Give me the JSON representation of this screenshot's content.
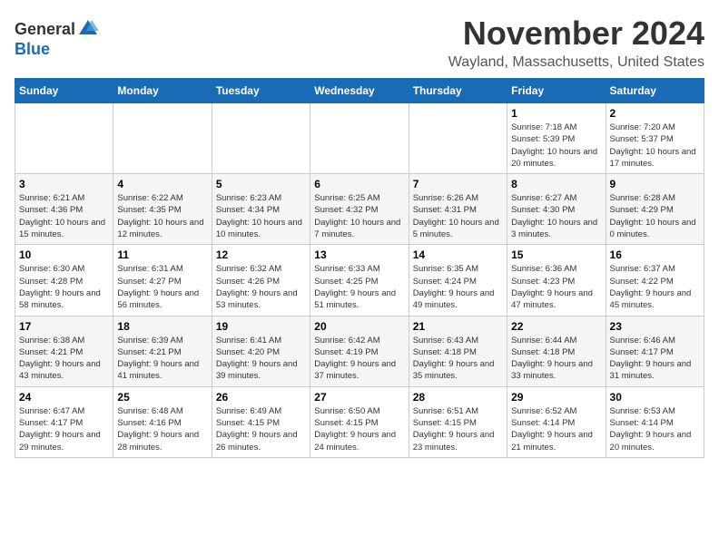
{
  "logo": {
    "general": "General",
    "blue": "Blue"
  },
  "header": {
    "month": "November 2024",
    "location": "Wayland, Massachusetts, United States"
  },
  "weekdays": [
    "Sunday",
    "Monday",
    "Tuesday",
    "Wednesday",
    "Thursday",
    "Friday",
    "Saturday"
  ],
  "weeks": [
    [
      {
        "day": "",
        "info": ""
      },
      {
        "day": "",
        "info": ""
      },
      {
        "day": "",
        "info": ""
      },
      {
        "day": "",
        "info": ""
      },
      {
        "day": "",
        "info": ""
      },
      {
        "day": "1",
        "info": "Sunrise: 7:18 AM\nSunset: 5:39 PM\nDaylight: 10 hours and 20 minutes."
      },
      {
        "day": "2",
        "info": "Sunrise: 7:20 AM\nSunset: 5:37 PM\nDaylight: 10 hours and 17 minutes."
      }
    ],
    [
      {
        "day": "3",
        "info": "Sunrise: 6:21 AM\nSunset: 4:36 PM\nDaylight: 10 hours and 15 minutes."
      },
      {
        "day": "4",
        "info": "Sunrise: 6:22 AM\nSunset: 4:35 PM\nDaylight: 10 hours and 12 minutes."
      },
      {
        "day": "5",
        "info": "Sunrise: 6:23 AM\nSunset: 4:34 PM\nDaylight: 10 hours and 10 minutes."
      },
      {
        "day": "6",
        "info": "Sunrise: 6:25 AM\nSunset: 4:32 PM\nDaylight: 10 hours and 7 minutes."
      },
      {
        "day": "7",
        "info": "Sunrise: 6:26 AM\nSunset: 4:31 PM\nDaylight: 10 hours and 5 minutes."
      },
      {
        "day": "8",
        "info": "Sunrise: 6:27 AM\nSunset: 4:30 PM\nDaylight: 10 hours and 3 minutes."
      },
      {
        "day": "9",
        "info": "Sunrise: 6:28 AM\nSunset: 4:29 PM\nDaylight: 10 hours and 0 minutes."
      }
    ],
    [
      {
        "day": "10",
        "info": "Sunrise: 6:30 AM\nSunset: 4:28 PM\nDaylight: 9 hours and 58 minutes."
      },
      {
        "day": "11",
        "info": "Sunrise: 6:31 AM\nSunset: 4:27 PM\nDaylight: 9 hours and 56 minutes."
      },
      {
        "day": "12",
        "info": "Sunrise: 6:32 AM\nSunset: 4:26 PM\nDaylight: 9 hours and 53 minutes."
      },
      {
        "day": "13",
        "info": "Sunrise: 6:33 AM\nSunset: 4:25 PM\nDaylight: 9 hours and 51 minutes."
      },
      {
        "day": "14",
        "info": "Sunrise: 6:35 AM\nSunset: 4:24 PM\nDaylight: 9 hours and 49 minutes."
      },
      {
        "day": "15",
        "info": "Sunrise: 6:36 AM\nSunset: 4:23 PM\nDaylight: 9 hours and 47 minutes."
      },
      {
        "day": "16",
        "info": "Sunrise: 6:37 AM\nSunset: 4:22 PM\nDaylight: 9 hours and 45 minutes."
      }
    ],
    [
      {
        "day": "17",
        "info": "Sunrise: 6:38 AM\nSunset: 4:21 PM\nDaylight: 9 hours and 43 minutes."
      },
      {
        "day": "18",
        "info": "Sunrise: 6:39 AM\nSunset: 4:21 PM\nDaylight: 9 hours and 41 minutes."
      },
      {
        "day": "19",
        "info": "Sunrise: 6:41 AM\nSunset: 4:20 PM\nDaylight: 9 hours and 39 minutes."
      },
      {
        "day": "20",
        "info": "Sunrise: 6:42 AM\nSunset: 4:19 PM\nDaylight: 9 hours and 37 minutes."
      },
      {
        "day": "21",
        "info": "Sunrise: 6:43 AM\nSunset: 4:18 PM\nDaylight: 9 hours and 35 minutes."
      },
      {
        "day": "22",
        "info": "Sunrise: 6:44 AM\nSunset: 4:18 PM\nDaylight: 9 hours and 33 minutes."
      },
      {
        "day": "23",
        "info": "Sunrise: 6:46 AM\nSunset: 4:17 PM\nDaylight: 9 hours and 31 minutes."
      }
    ],
    [
      {
        "day": "24",
        "info": "Sunrise: 6:47 AM\nSunset: 4:17 PM\nDaylight: 9 hours and 29 minutes."
      },
      {
        "day": "25",
        "info": "Sunrise: 6:48 AM\nSunset: 4:16 PM\nDaylight: 9 hours and 28 minutes."
      },
      {
        "day": "26",
        "info": "Sunrise: 6:49 AM\nSunset: 4:15 PM\nDaylight: 9 hours and 26 minutes."
      },
      {
        "day": "27",
        "info": "Sunrise: 6:50 AM\nSunset: 4:15 PM\nDaylight: 9 hours and 24 minutes."
      },
      {
        "day": "28",
        "info": "Sunrise: 6:51 AM\nSunset: 4:15 PM\nDaylight: 9 hours and 23 minutes."
      },
      {
        "day": "29",
        "info": "Sunrise: 6:52 AM\nSunset: 4:14 PM\nDaylight: 9 hours and 21 minutes."
      },
      {
        "day": "30",
        "info": "Sunrise: 6:53 AM\nSunset: 4:14 PM\nDaylight: 9 hours and 20 minutes."
      }
    ]
  ]
}
